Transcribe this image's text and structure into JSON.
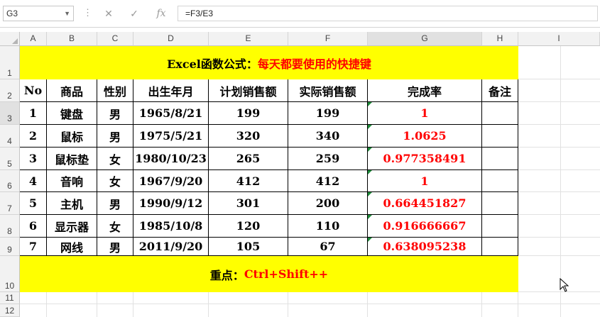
{
  "formula_bar": {
    "name_box": "G3",
    "cancel_icon": "close-icon",
    "enter_icon": "check-icon",
    "fx_label": "fx",
    "formula": "=F3/E3"
  },
  "columns": [
    "A",
    "B",
    "C",
    "D",
    "E",
    "F",
    "G",
    "H",
    "I"
  ],
  "rows": [
    "1",
    "2",
    "3",
    "4",
    "5",
    "6",
    "7",
    "8",
    "9",
    "10",
    "11",
    "12"
  ],
  "title": {
    "black": "Excel函数公式：",
    "red": "每天都要使用的快捷键"
  },
  "table": {
    "headers": [
      "No",
      "商品",
      "性别",
      "出生年月",
      "计划销售额",
      "实际销售额",
      "完成率",
      "备注"
    ],
    "rows": [
      [
        "1",
        "键盘",
        "男",
        "1965/8/21",
        "199",
        "199",
        "1",
        ""
      ],
      [
        "2",
        "鼠标",
        "男",
        "1975/5/21",
        "320",
        "340",
        "1.0625",
        ""
      ],
      [
        "3",
        "鼠标垫",
        "女",
        "1980/10/23",
        "265",
        "259",
        "0.977358491",
        ""
      ],
      [
        "4",
        "音响",
        "女",
        "1967/9/20",
        "412",
        "412",
        "1",
        ""
      ],
      [
        "5",
        "主机",
        "男",
        "1990/9/12",
        "301",
        "200",
        "0.664451827",
        ""
      ],
      [
        "6",
        "显示器",
        "女",
        "1985/10/8",
        "120",
        "110",
        "0.916666667",
        ""
      ],
      [
        "7",
        "网线",
        "男",
        "2011/9/20",
        "105",
        "67",
        "0.638095238",
        ""
      ]
    ]
  },
  "footer": {
    "black": "重点：",
    "red": "Ctrl+Shift++"
  },
  "colors": {
    "highlight": "#ffff00",
    "accent_red": "#ff0000",
    "selection": "#217346"
  }
}
